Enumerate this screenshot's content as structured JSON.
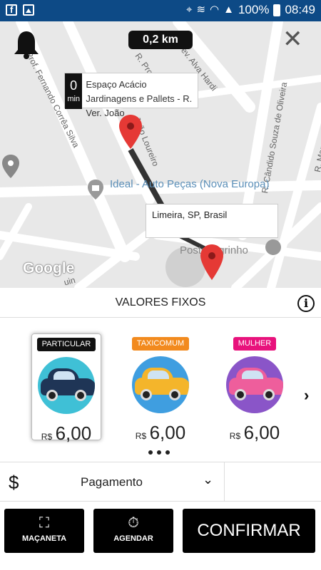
{
  "status_bar": {
    "icons_left": [
      "facebook-icon",
      "image-icon"
    ],
    "battery": "100%",
    "time": "08:49"
  },
  "map": {
    "distance": "0,2 km",
    "eta": {
      "value": "0",
      "unit": "min",
      "place": "Espaço Acácio Jardinagens e Pallets - R. Ver. João"
    },
    "destination": "Limeira, SP, Brasil",
    "streets": {
      "prof_fernando": "Prof. Fernando Corrêa Silva",
      "prof": "R. Prof.",
      "alva_hardi": "ev. Alva Hardi",
      "joao_loureiro": "João Loureiro",
      "candido": "R. Cândido Souza de Oliveira",
      "marech": "R. Marech",
      "ain": "uin"
    },
    "pois": {
      "ideal": "Ideal - Auto Peças (Nova Europa)",
      "posto": "Posto Tigrinho"
    },
    "attribution": "Google"
  },
  "fixed_values": {
    "title": "VALORES FIXOS"
  },
  "services": [
    {
      "tag": "PARTICULAR",
      "tag_color": "#111111",
      "circle_color": "#3fc0d6",
      "car_color": "#1f3556",
      "currency": "R$",
      "price": "6,00",
      "selected": true
    },
    {
      "tag": "TAXICOMUM",
      "tag_color": "#f28a1e",
      "circle_color": "#3f9ee0",
      "car_color": "#f4b52b",
      "currency": "R$",
      "price": "6,00",
      "selected": false
    },
    {
      "tag": "MULHER",
      "tag_color": "#e8127c",
      "circle_color": "#8a55c8",
      "car_color": "#ee5e9c",
      "currency": "R$",
      "price": "6,00",
      "selected": false
    }
  ],
  "payment": {
    "icon": "$",
    "label": "Pagamento"
  },
  "buttons": {
    "macaneta": "MAÇANETA",
    "agendar": "AGENDAR",
    "confirmar": "CONFIRMAR"
  }
}
